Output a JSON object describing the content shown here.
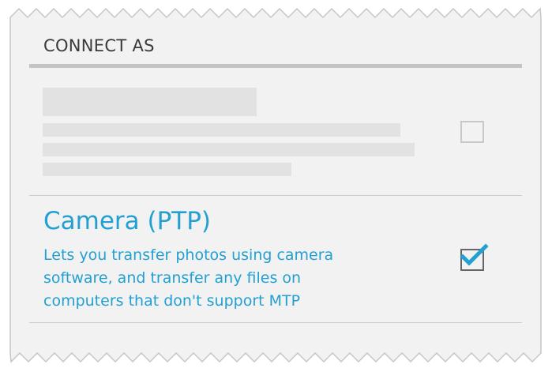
{
  "dialog": {
    "title": "CONNECT AS",
    "options": [
      {
        "id": "mtp",
        "placeholder": true,
        "checked": false
      },
      {
        "id": "ptp",
        "title": "Camera (PTP)",
        "description_lines": [
          "Lets you transfer photos using camera",
          "software, and transfer any files on",
          "computers that don't support MTP"
        ],
        "checked": true
      }
    ]
  },
  "colors": {
    "accent": "#23a0d2",
    "background": "#f2f2f2",
    "placeholder": "#e2e2e2",
    "header_rule": "#c4c4c4"
  },
  "icons": {
    "checked_checkbox": "checkmark-icon",
    "unchecked_checkbox": "empty-checkbox"
  }
}
